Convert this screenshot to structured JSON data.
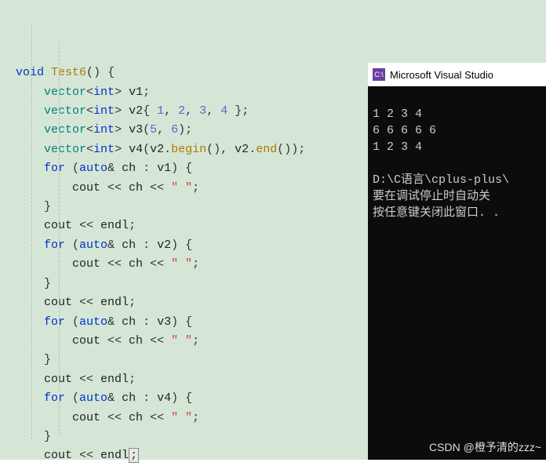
{
  "code": {
    "fn_kw": "void",
    "fn_name": "Test6",
    "fn_params": "()",
    "obr": " {",
    "l2_a": "vector",
    "l2_b": "<",
    "l2_c": "int",
    "l2_d": "> ",
    "l2_e": "v1",
    "l2_f": ";",
    "l3_a": "vector",
    "l3_b": "<",
    "l3_c": "int",
    "l3_d": "> ",
    "l3_e": "v2",
    "l3_f": "{ ",
    "l3_g": "1",
    "l3_h": ", ",
    "l3_i": "2",
    "l3_j": ", ",
    "l3_k": "3",
    "l3_l": ", ",
    "l3_m": "4",
    "l3_n": " };",
    "l4_a": "vector",
    "l4_b": "<",
    "l4_c": "int",
    "l4_d": "> ",
    "l4_e": "v3",
    "l4_f": "(",
    "l4_g": "5",
    "l4_h": ", ",
    "l4_i": "6",
    "l4_j": ");",
    "l5_a": "vector",
    "l5_b": "<",
    "l5_c": "int",
    "l5_d": "> ",
    "l5_e": "v4",
    "l5_f": "(",
    "l5_g": "v2",
    "l5_h": ".",
    "l5_i": "begin",
    "l5_j": "(), ",
    "l5_k": "v2",
    "l5_l": ".",
    "l5_m": "end",
    "l5_n": "());",
    "for_kw": "for",
    "for_open": " (",
    "auto_kw": "auto",
    "amp": "& ",
    "ch_id": "ch",
    "colon": " : ",
    "v1_id": "v1",
    "v2_id": "v2",
    "v3_id": "v3",
    "v4_id": "v4",
    "for_close": ") {",
    "cout_id": "cout",
    "ins_op": " << ",
    "space_str": "\" \"",
    "semi": ";",
    "cbr": "}",
    "endl_id": "endl"
  },
  "console": {
    "title_icon": "C:\\",
    "title": " Microsoft Visual Studio",
    "line1": "1 2 3 4",
    "line2": "6 6 6 6 6",
    "line3": "1 2 3 4",
    "line4": "",
    "line5": "D:\\C语言\\cplus-plus\\",
    "line6": "要在调试停止时自动关",
    "line7": "按任意键关闭此窗口. ."
  },
  "watermark": "CSDN @橙予清的zzz~"
}
